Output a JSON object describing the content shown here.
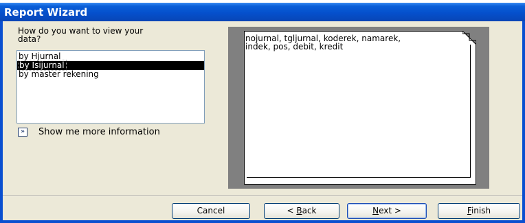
{
  "window": {
    "title": "Report Wizard"
  },
  "left": {
    "question_line1": "How do you want to view your",
    "question_line2": "data?",
    "options": [
      "by Hjurnal",
      "by Isijurnal",
      "by master rekening"
    ],
    "selected_option": "by Isijurnal",
    "more_info_label": "Show me more information"
  },
  "preview": {
    "fields_line1": "nojurnal, tgljurnal, koderek, namarek,",
    "fields_line2": "indek, pos, debit, kredit"
  },
  "buttons": {
    "cancel": "Cancel",
    "back_arrow": "< ",
    "back_hotkey": "B",
    "back_rest": "ack",
    "next_hotkey": "N",
    "next_rest": "ext >",
    "finish_hotkey": "F",
    "finish_rest": "inish",
    "default": "Next"
  },
  "colors": {
    "titlebar": "#0550cc",
    "dialog_background": "#ece9d8",
    "selection": "#000000",
    "preview_frame": "#808080"
  },
  "icons": {
    "more_info": "double-chevron-right-icon"
  }
}
